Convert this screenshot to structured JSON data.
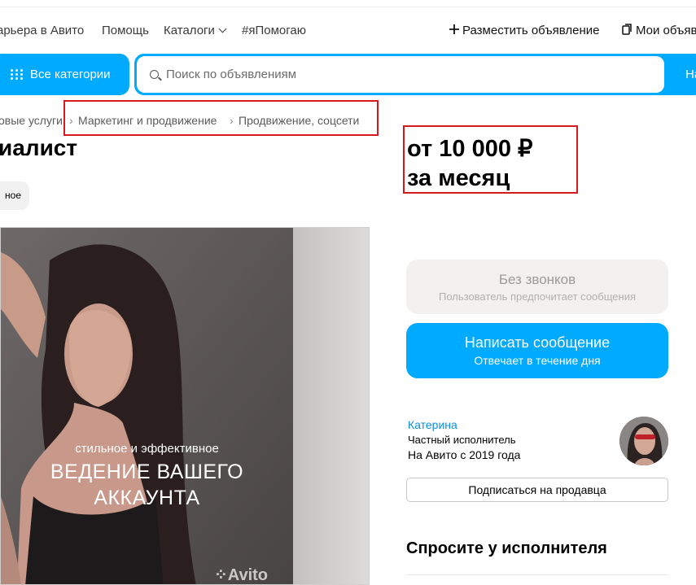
{
  "header": {
    "nav_items": [
      "арьера в Авито",
      "Помощь",
      "Каталоги",
      "#яПомогаю"
    ],
    "post_ad": "Разместить объявление",
    "my_ads": "Мои объяв"
  },
  "search": {
    "categories_label": "Все категории",
    "placeholder": "Поиск по объявлениям",
    "button_label": "На"
  },
  "breadcrumbs": [
    "овые услуги",
    "Маркетинг и продвижение",
    "Продвижение, соцсети"
  ],
  "listing": {
    "title": "иалист",
    "tag": "ное",
    "price_line1": "от 10 000 ₽",
    "price_line2": "за месяц",
    "photo_caption_small": "стильное и эффективное",
    "photo_caption_big1": "ВЕДЕНИЕ ВАШЕГО",
    "photo_caption_big2": "АККАУНТА",
    "photo_watermark": "Avito"
  },
  "actions": {
    "no_calls_title": "Без звонков",
    "no_calls_sub": "Пользователь предпочитает сообщения",
    "message_title": "Написать сообщение",
    "message_sub": "Отвечает в течение дня"
  },
  "seller": {
    "name": "Катерина",
    "type": "Частный исполнитель",
    "since": "На Авито с 2019 года",
    "subscribe": "Подписаться на продавца"
  },
  "ask_title": "Спросите у исполнителя",
  "colors": {
    "accent": "#00aaff",
    "highlight": "#d6181f",
    "link": "#0a8fd8"
  }
}
